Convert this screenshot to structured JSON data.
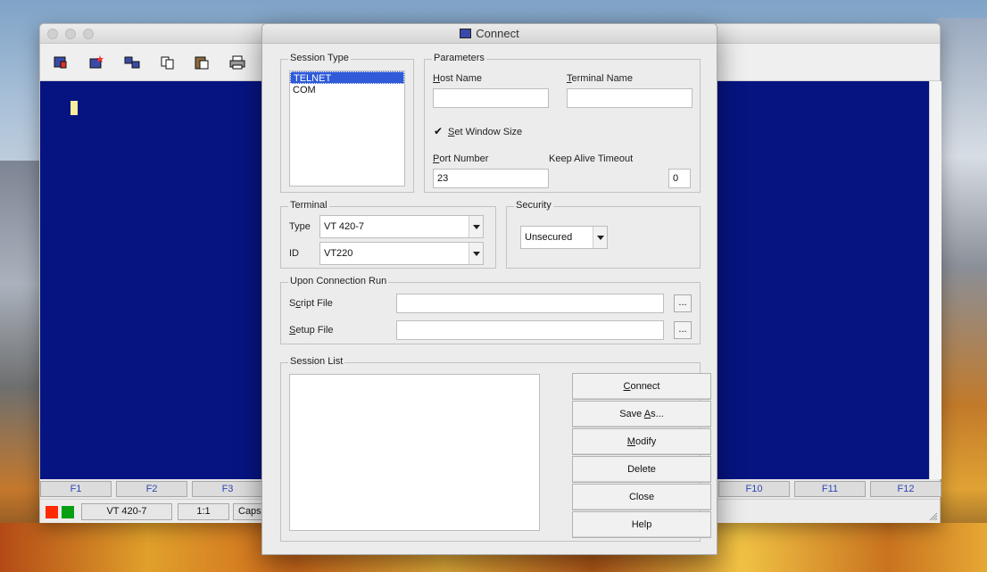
{
  "desktop": {},
  "terminal_window": {
    "toolbar": {
      "icons": [
        "disconnect-icon",
        "new-session-icon",
        "network-icon",
        "copy-icon",
        "paste-icon",
        "print-icon"
      ]
    },
    "function_keys": [
      "F1",
      "F2",
      "F3",
      "F10",
      "F11",
      "F12"
    ],
    "status": {
      "terminal_type": "VT 420-7",
      "ratio": "1:1",
      "caps": "Caps",
      "led_colors": [
        "#ff2a00",
        "#07a013"
      ]
    },
    "screen_color": "#061482"
  },
  "dialog": {
    "title": "Connect",
    "session_type": {
      "label": "Session Type",
      "items": [
        "TELNET",
        "COM"
      ],
      "selected": "TELNET"
    },
    "parameters": {
      "label": "Parameters",
      "host_name_label_first": "H",
      "host_name_label_rest": "ost Name",
      "host_name_value": "",
      "terminal_name_label_first": "T",
      "terminal_name_label_rest": "erminal Name",
      "terminal_name_value": "",
      "set_window_size_checked": "✔",
      "set_window_size_label_first": "S",
      "set_window_size_label_rest": "et Window Size",
      "port_number_label_first": "P",
      "port_number_label_rest": "ort Number",
      "port_number_value": "23",
      "keep_alive_label": "Keep Alive Timeout",
      "keep_alive_value": "0"
    },
    "terminal": {
      "label": "Terminal",
      "type_label": "Type",
      "type_value": "VT 420-7",
      "id_label": "ID",
      "id_value": "VT220"
    },
    "security": {
      "label": "Security",
      "value": "Unsecured"
    },
    "upon_connection": {
      "label": "Upon Connection Run",
      "script_label_first": "S",
      "script_label_mid": "c",
      "script_label_rest": "ript File",
      "setup_label_first": "S",
      "setup_label_rest": "etup File",
      "script_value": "",
      "setup_value": "",
      "browse": "..."
    },
    "session_list": {
      "label": "Session List"
    },
    "buttons": {
      "connect_first": "C",
      "connect_rest": "onnect",
      "save_as_pre": "Save ",
      "save_as_ul": "A",
      "save_as_post": "s...",
      "modify_first": "M",
      "modify_rest": "odify",
      "delete": "Delete",
      "close": "Close",
      "help": "Help"
    }
  }
}
